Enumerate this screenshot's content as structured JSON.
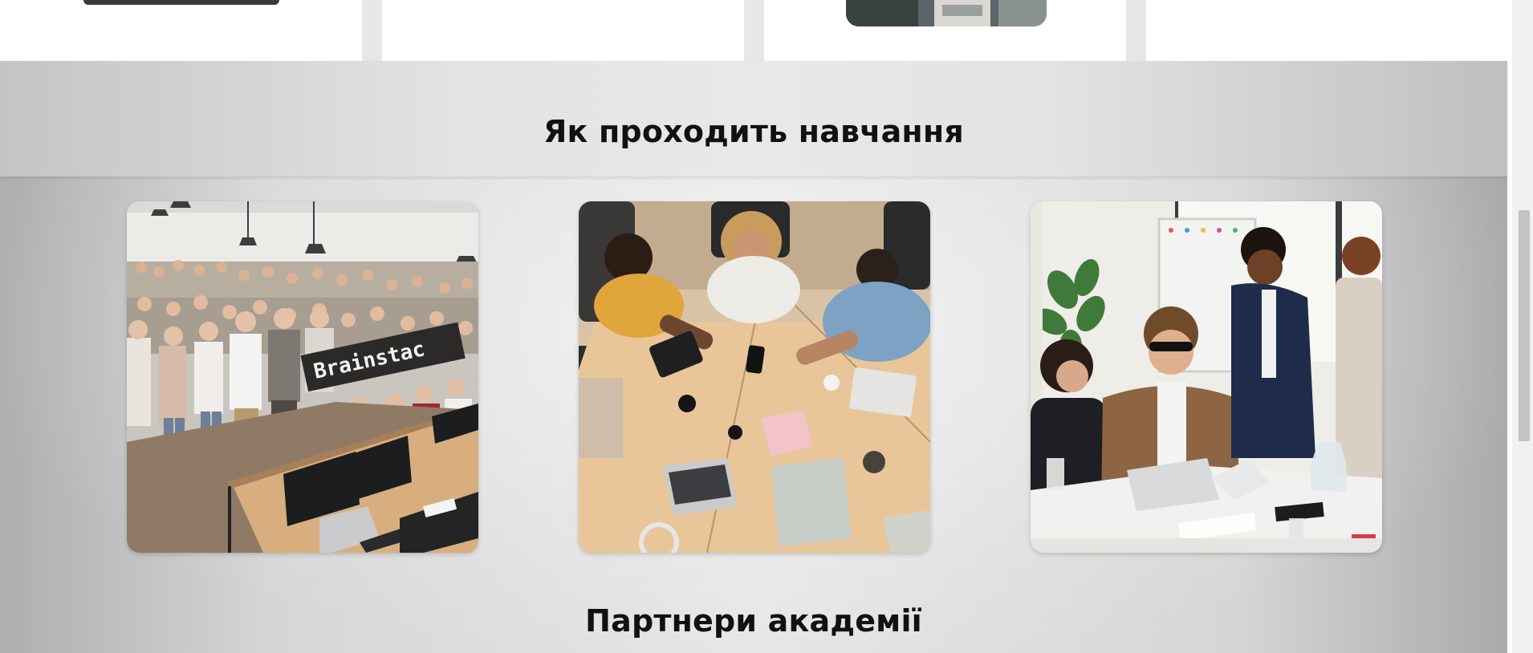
{
  "sections": {
    "learning": {
      "title": "Як проходить навчання",
      "photos": [
        {
          "subject": "group-photo",
          "banner_text": "Brainstac"
        },
        {
          "subject": "teamwork-table"
        },
        {
          "subject": "business-meeting"
        }
      ]
    },
    "partners": {
      "title": "Партнери академії"
    }
  },
  "colors": {
    "section_bg": "#d9d9d9",
    "title_text": "#111111",
    "card_bg": "#ffffff"
  }
}
